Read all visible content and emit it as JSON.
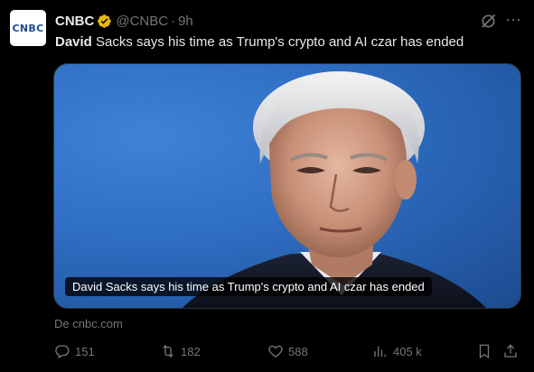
{
  "tweet": {
    "avatar_text": "CNBC",
    "name": "CNBC",
    "handle": "@CNBC",
    "separator": "·",
    "time": "9h",
    "text_bold": "David",
    "text_rest": " Sacks says his time as Trump's crypto and AI czar has ended"
  },
  "card": {
    "caption": "David Sacks says his time as Trump's crypto and AI czar has ended",
    "source": "De cnbc.com"
  },
  "actions": {
    "replies": "151",
    "reposts": "182",
    "likes": "588",
    "views": "405 k"
  },
  "icons": {
    "verified": "verified-badge-icon",
    "grok": "grok-icon",
    "more": "more-icon",
    "reply": "reply-icon",
    "repost": "repost-icon",
    "like": "heart-icon",
    "views": "views-icon",
    "bookmark": "bookmark-icon",
    "share": "share-icon"
  },
  "colors": {
    "background": "#000000",
    "text": "#e7e9ea",
    "muted": "#71767b",
    "verified": "#e2b719"
  }
}
